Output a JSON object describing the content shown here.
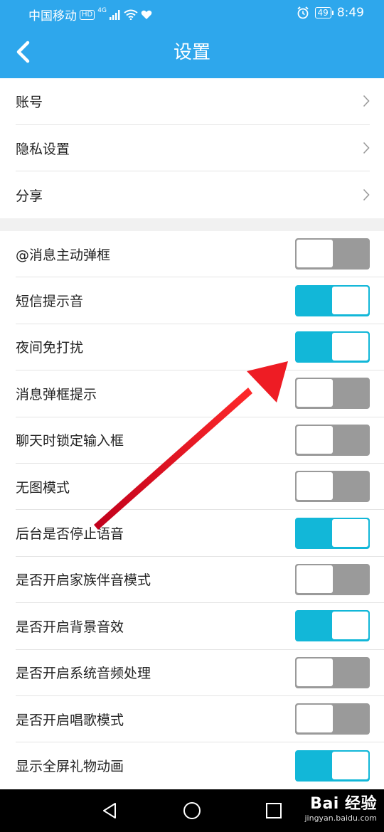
{
  "status_bar": {
    "carrier": "中国移动",
    "hd": "HD",
    "network": "4G",
    "battery": "49",
    "time": "8:49"
  },
  "header": {
    "title": "设置"
  },
  "nav_items": [
    {
      "label": "账号"
    },
    {
      "label": "隐私设置"
    },
    {
      "label": "分享"
    }
  ],
  "toggle_items": [
    {
      "label": "@消息主动弹框",
      "on": false
    },
    {
      "label": "短信提示音",
      "on": true
    },
    {
      "label": "夜间免打扰",
      "on": true
    },
    {
      "label": "消息弹框提示",
      "on": false
    },
    {
      "label": "聊天时锁定输入框",
      "on": false
    },
    {
      "label": "无图模式",
      "on": false
    },
    {
      "label": "后台是否停止语音",
      "on": true
    },
    {
      "label": "是否开启家族伴音模式",
      "on": false
    },
    {
      "label": "是否开启背景音效",
      "on": true
    },
    {
      "label": "是否开启系统音频处理",
      "on": false
    },
    {
      "label": "是否开启唱歌模式",
      "on": false
    },
    {
      "label": "显示全屏礼物动画",
      "on": true
    }
  ],
  "watermark": {
    "logo": "Bai 经验",
    "url": "jingyan.baidu.com"
  },
  "colors": {
    "header": "#2ea7ec",
    "toggle_on": "#12b7d8",
    "toggle_off": "#9a9a9a",
    "arrow": "#e8141a"
  }
}
